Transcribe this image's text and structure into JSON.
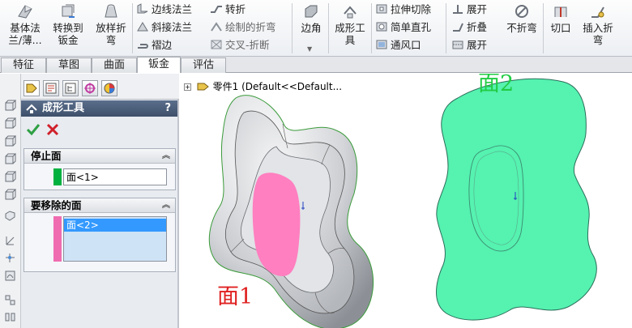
{
  "ribbon": {
    "large_buttons": [
      {
        "label": "基体法\n兰/薄...",
        "icon": "base-flange-icon"
      },
      {
        "label": "转换到\n钣金",
        "icon": "convert-to-sheetmetal-icon"
      },
      {
        "label": "放样折\n弯",
        "icon": "lofted-bend-icon"
      }
    ],
    "group1": [
      {
        "label": "边线法兰",
        "icon": "edge-flange-icon"
      },
      {
        "label": "斜接法兰",
        "icon": "miter-flange-icon"
      },
      {
        "label": "褶边",
        "icon": "hem-icon"
      }
    ],
    "group2": [
      {
        "label": "转折",
        "icon": "jog-icon"
      },
      {
        "label": "绘制的折弯",
        "icon": "sketched-bend-icon"
      },
      {
        "label": "交叉-折断",
        "icon": "cross-break-icon"
      }
    ],
    "corner": {
      "label": "边角",
      "icon": "corner-icon"
    },
    "forming_tool": {
      "label": "成形工\n具",
      "icon": "forming-tool-icon"
    },
    "group3": [
      {
        "label": "拉伸切除",
        "icon": "extruded-cut-icon"
      },
      {
        "label": "简单直孔",
        "icon": "simple-hole-icon"
      },
      {
        "label": "通风口",
        "icon": "vent-icon"
      }
    ],
    "group4": [
      {
        "label": "展开",
        "icon": "unfold-icon"
      },
      {
        "label": "折叠",
        "icon": "fold-icon"
      },
      {
        "label": "展开",
        "icon": "flatten-icon"
      }
    ],
    "no_bends": {
      "label": "不折弯",
      "icon": "no-bends-icon"
    },
    "rip": {
      "label": "切口",
      "icon": "rip-icon"
    },
    "insert_bends": {
      "label": "插入折\n弯",
      "icon": "insert-bends-icon"
    }
  },
  "tabs": [
    "特征",
    "草图",
    "曲面",
    "钣金",
    "评估"
  ],
  "active_tab": "钣金",
  "property_manager": {
    "title": "成形工具",
    "help": "?",
    "stop_face": {
      "title": "停止面",
      "items": [
        "面<1>"
      ],
      "color": "#00b140"
    },
    "faces_to_remove": {
      "title": "要移除的面",
      "items": [
        "面<2>"
      ],
      "color": "#ef6cb0"
    }
  },
  "graphics": {
    "tree_item": "零件1  (Default<<Default...",
    "label_face1": "面1",
    "label_face2": "面2",
    "face1_color": "#ff7fc0",
    "face2_color": "#55f2b0"
  }
}
